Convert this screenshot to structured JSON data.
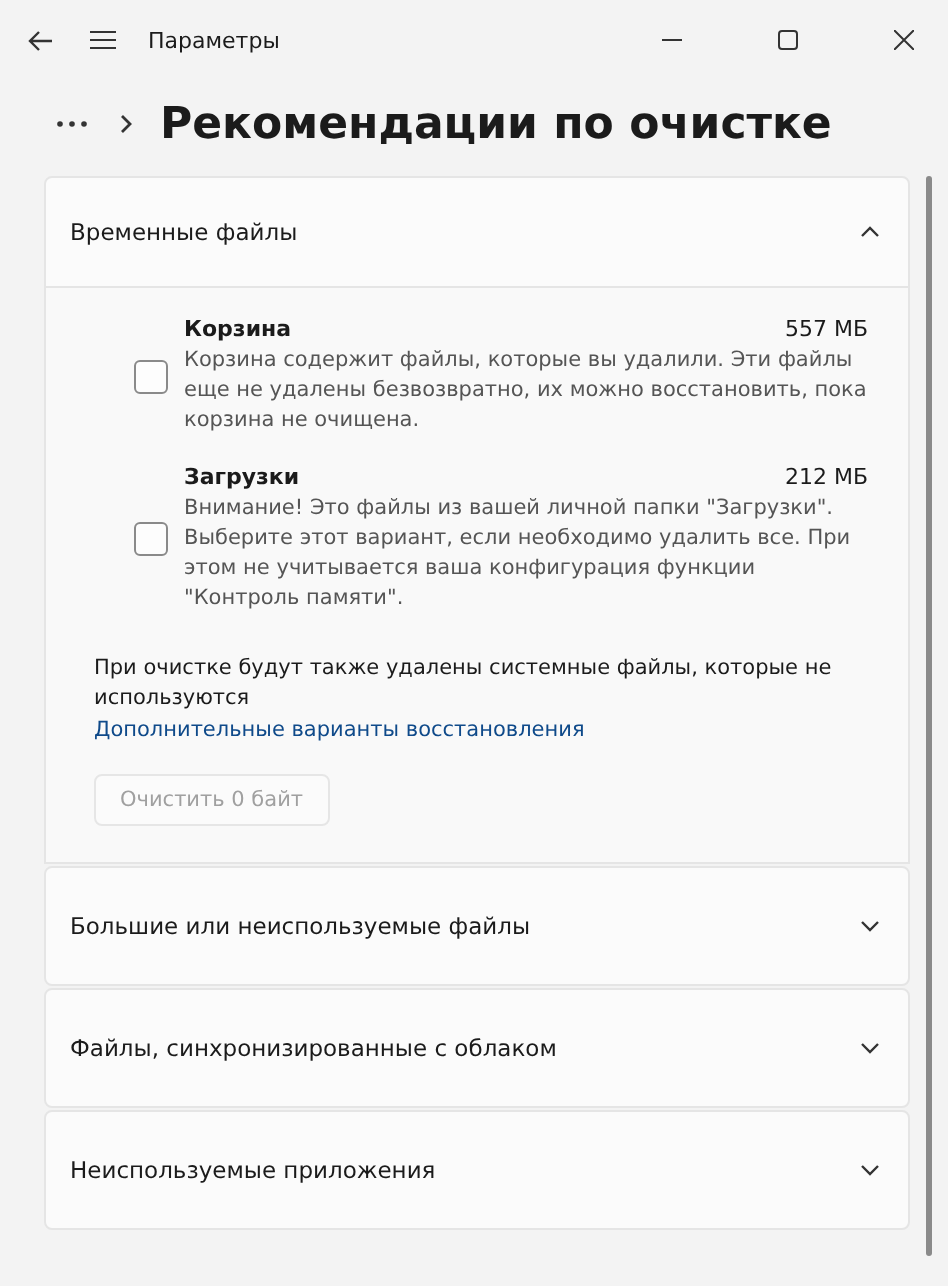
{
  "window": {
    "title": "Параметры"
  },
  "breadcrumb": {
    "title": "Рекомендации по очистке"
  },
  "sections": [
    {
      "title": "Временные файлы",
      "expanded": true,
      "items": [
        {
          "name": "Корзина",
          "size": "557 МБ",
          "checked": false,
          "description": "Корзина содержит файлы, которые вы удалили. Эти файлы еще не удалены безвозвратно, их можно восстановить, пока корзина не очищена."
        },
        {
          "name": "Загрузки",
          "size": "212 МБ",
          "checked": false,
          "description": "Внимание! Это файлы из вашей личной папки \"Загрузки\". Выберите этот вариант, если необходимо удалить все. При этом не учитывается ваша конфигурация функции \"Контроль памяти\"."
        }
      ],
      "note": "При очистке будут также удалены системные файлы, которые не используются",
      "link": "Дополнительные варианты восстановления",
      "button": {
        "label": "Очистить 0 байт",
        "disabled": true
      }
    },
    {
      "title": "Большие или неиспользуемые файлы",
      "expanded": false
    },
    {
      "title": "Файлы, синхронизированные с облаком",
      "expanded": false
    },
    {
      "title": "Неиспользуемые приложения",
      "expanded": false
    }
  ]
}
